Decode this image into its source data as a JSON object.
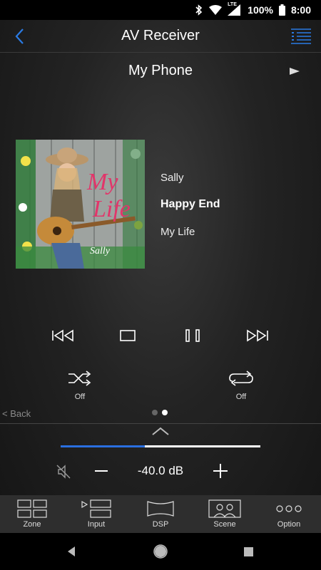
{
  "status_bar": {
    "battery_percent": "100%",
    "time": "8:00",
    "network": "LTE"
  },
  "header": {
    "title": "AV Receiver"
  },
  "source": {
    "name": "My Phone"
  },
  "now_playing": {
    "artist": "Sally",
    "song": "Happy End",
    "album": "My Life",
    "album_art_text": "My Life",
    "album_art_signature": "Sally"
  },
  "modes": {
    "shuffle_label": "Off",
    "repeat_label": "Off"
  },
  "back_link": "< Back",
  "page_indicator": {
    "count": 2,
    "active_index": 1
  },
  "volume": {
    "value": "-40.0 dB",
    "level_fraction": 0.42,
    "muted": false
  },
  "tabs": [
    {
      "label": "Zone"
    },
    {
      "label": "Input"
    },
    {
      "label": "DSP"
    },
    {
      "label": "Scene"
    },
    {
      "label": "Option"
    }
  ],
  "colors": {
    "accent": "#2a6fe0",
    "tab_bar": "#2e2e2e",
    "background": "#1e1e1e"
  }
}
